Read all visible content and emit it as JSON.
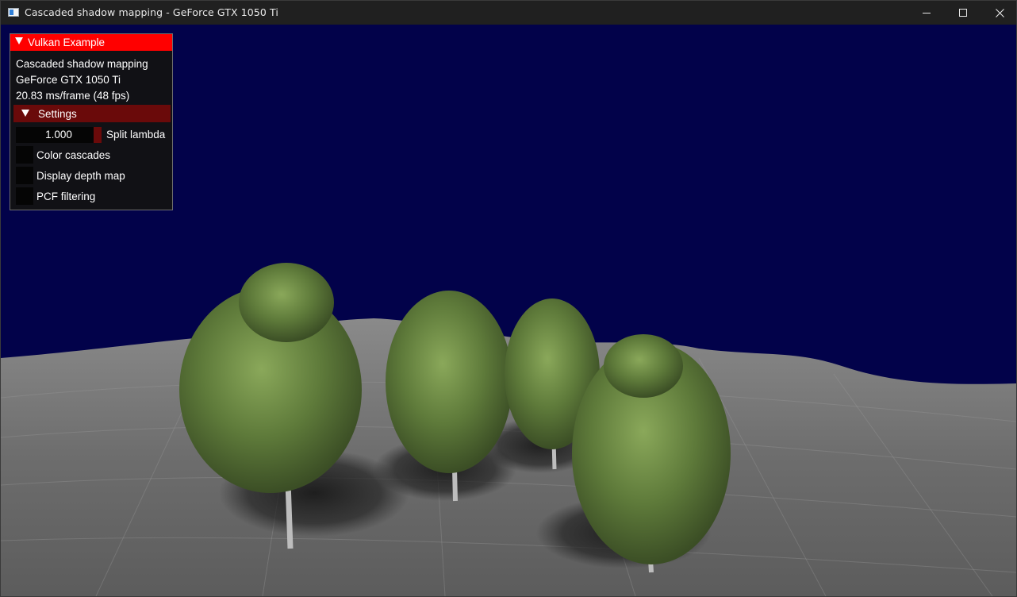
{
  "window": {
    "title": "Cascaded shadow mapping - GeForce GTX 1050 Ti",
    "minimize_icon": "minimize-icon",
    "maximize_icon": "maximize-icon",
    "close_icon": "close-icon"
  },
  "colors": {
    "sky": "#02024a",
    "terrain": "#6e6e6e",
    "overlay_header": "#ff0000",
    "settings_header": "#6a0a0a"
  },
  "overlay": {
    "title": "Vulkan Example",
    "app_name": "Cascaded shadow mapping",
    "gpu": "GeForce GTX 1050 Ti",
    "frame_stats": "20.83 ms/frame (48 fps)",
    "settings": {
      "header": "Settings",
      "split_lambda": {
        "value": "1.000",
        "label": "Split lambda"
      },
      "checkboxes": [
        {
          "label": "Color cascades",
          "checked": false
        },
        {
          "label": "Display depth map",
          "checked": false
        },
        {
          "label": "PCF filtering",
          "checked": false
        }
      ]
    }
  }
}
